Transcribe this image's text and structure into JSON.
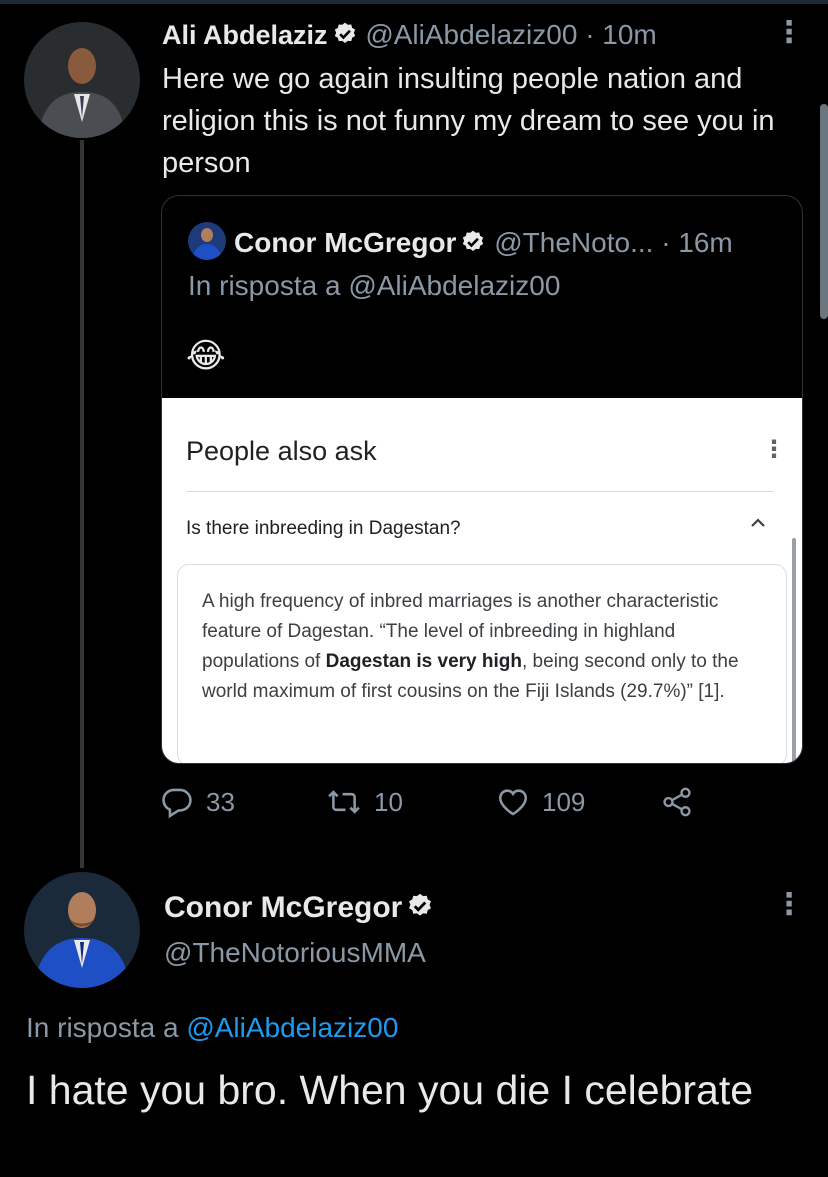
{
  "tweet1": {
    "name": "Ali Abdelaziz",
    "handle": "@AliAbdelaziz00",
    "time": "· 10m",
    "text": "Here we go again insulting people nation and religion this is not funny my dream to see you in person",
    "quote": {
      "name": "Conor McGregor",
      "handle": "@TheNoto...",
      "time": "· 16m",
      "reply_prefix": "In risposta a",
      "reply_to": "@AliAbdelaziz00",
      "emoji": "😂",
      "screenshot": {
        "title": "People also ask",
        "question": "Is there inbreeding in Dagestan?",
        "answer_part1": "A high frequency of inbred marriages is another characteristic feature of Dagestan. “The level of inbreeding in highland populations of ",
        "answer_bold": "Dagestan is very high",
        "answer_part2": ", being second only to the world maximum of first cousins on the Fiji Islands (29.7%)” [1]."
      }
    },
    "actions": {
      "replies": "33",
      "retweets": "10",
      "likes": "109"
    }
  },
  "tweet2": {
    "name": "Conor McGregor",
    "handle": "@TheNotoriousMMA",
    "reply_prefix": "In risposta a",
    "reply_to": "@AliAbdelaziz00",
    "text": "I hate you bro. When you die I celebrate"
  },
  "colors": {
    "background": "#000000",
    "text": "#e7e9ea",
    "muted": "#8b98a5",
    "link": "#1d9bf0"
  },
  "icons": [
    "verified-badge-icon",
    "more-vertical-icon",
    "reply-icon",
    "retweet-icon",
    "like-icon",
    "share-icon",
    "chevron-up-icon"
  ]
}
